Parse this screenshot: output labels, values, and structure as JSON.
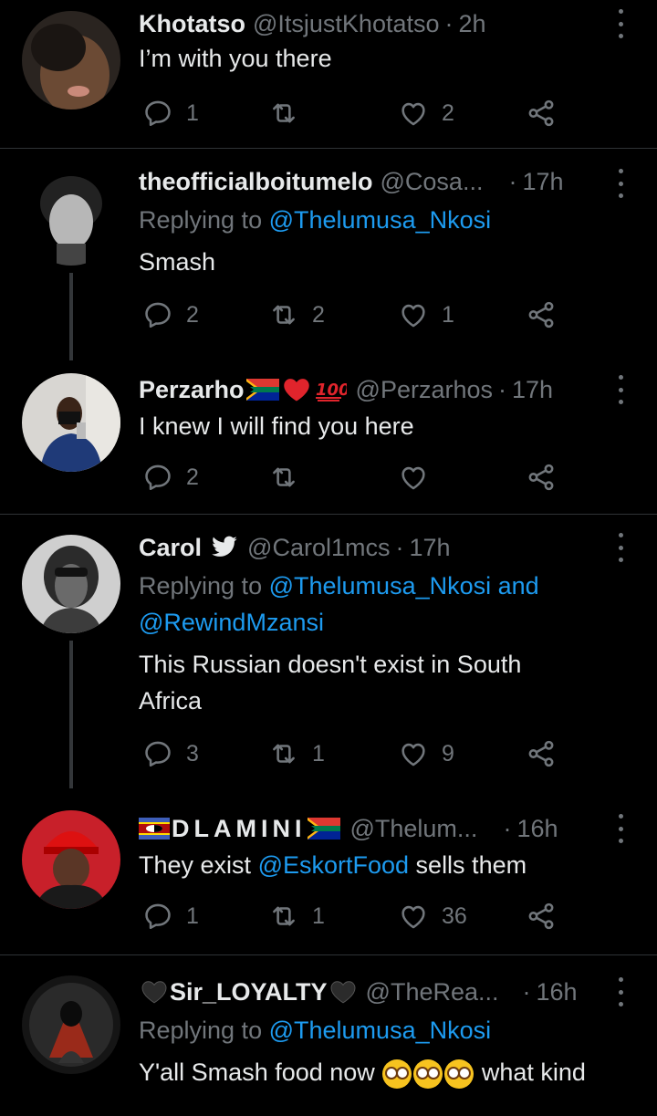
{
  "tweets": [
    {
      "name": "Khotatso",
      "handle": "@ItsjustKhotatso",
      "time": "2h",
      "text": "I’m with you there",
      "replies": "1",
      "retweets": "",
      "likes": "2"
    },
    {
      "name": "theofficialboitumelo",
      "handle": "@Cosa...",
      "time": "17h",
      "replying_prefix": "Replying to",
      "replying_to": "@Thelumusa_Nkosi",
      "text": "Smash",
      "replies": "2",
      "retweets": "2",
      "likes": "1"
    },
    {
      "name": "Perzarho",
      "handle": "@Perzarhos",
      "time": "17h",
      "text": "I knew I will find you here",
      "replies": "2",
      "retweets": "",
      "likes": ""
    },
    {
      "name": "Carol",
      "handle": "@Carol1mcs",
      "time": "17h",
      "replying_prefix": "Replying to",
      "replying_to": "@Thelumusa_Nkosi and",
      "replying_to_2": "@RewindMzansi",
      "text_line1": "This Russian doesn't exist in South",
      "text_line2": "Africa",
      "replies": "3",
      "retweets": "1",
      "likes": "9"
    },
    {
      "name": "DLAMINI",
      "handle": "@Thelum...",
      "time": "16h",
      "text_prefix": "They exist",
      "text_mention": "@EskortFood",
      "text_suffix": "sells them",
      "replies": "1",
      "retweets": "1",
      "likes": "36"
    },
    {
      "name": "Sir_LOYALTY",
      "handle": "@TheRea...",
      "time": "16h",
      "replying_prefix": "Replying to",
      "replying_to": "@Thelumusa_Nkosi",
      "text_start": "Y'all Smash food now",
      "text_end": "what kind"
    }
  ],
  "separator": "·",
  "icons": {
    "reply": "reply-bubble-icon",
    "retweet": "retweet-icon",
    "like": "heart-icon",
    "share": "share-icon",
    "more": "more-vertical-icon"
  },
  "colors": {
    "background": "#000000",
    "text": "#e7e9ea",
    "muted": "#71767b",
    "link": "#1d9bf0"
  }
}
